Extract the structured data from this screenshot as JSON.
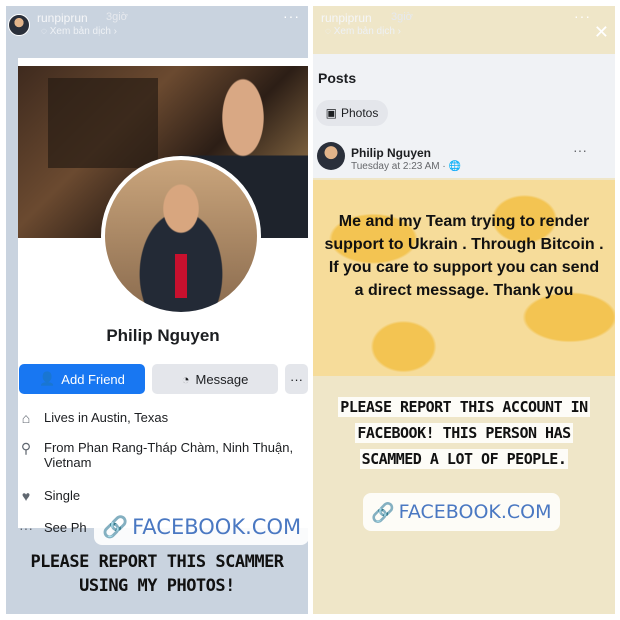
{
  "story": {
    "username": "runpiprun",
    "time": "3giờ",
    "translate": "Xem bản dịch",
    "more": "···",
    "close": "✕"
  },
  "left": {
    "profile_name": "Philip Nguyen",
    "buttons": {
      "add_friend": "Add Friend",
      "message": "Message",
      "more": "···"
    },
    "info": {
      "lives_prefix": "Lives in ",
      "lives_place": "Austin, Texas",
      "from_prefix": "From ",
      "from_place": "Phan Rang-Tháp Chàm, Ninh Thuận, Vietnam",
      "relationship": "Single",
      "see_more": "See Ph"
    },
    "watermark": "FACEBOOK.COM",
    "caption_line1": "PLEASE REPORT THIS SCAMMER",
    "caption_line2": "USING MY PHOTOS!"
  },
  "right": {
    "posts_title": "Posts",
    "photos_button": "Photos",
    "post": {
      "author": "Philip Nguyen",
      "time": "Tuesday at 2:23 AM · 🌐",
      "more": "···",
      "message": "Me and my Team trying to render support to Ukrain . Through Bitcoin . If you care to support you can send a direct message. Thank you"
    },
    "caption_line1": "PLEASE REPORT THIS ACCOUNT IN",
    "caption_line2": "FACEBOOK! THIS PERSON HAS",
    "caption_line3": "SCAMMED A LOT OF PEOPLE.",
    "watermark": "FACEBOOK.COM"
  },
  "icons": [
    "link-icon",
    "person-add-icon",
    "messenger-icon",
    "home-icon",
    "location-pin-icon",
    "heart-icon",
    "ellipsis-icon",
    "photo-icon",
    "globe-icon"
  ],
  "colors": {
    "facebook_blue": "#1877f2",
    "link_blue": "#4a78c2",
    "post_yellow": "#f6dc9a"
  }
}
